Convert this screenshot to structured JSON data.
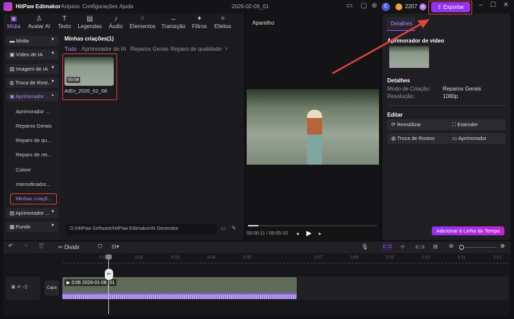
{
  "app": {
    "title": "HitPaw Edimakor",
    "menu": [
      "Arquivo",
      "Configurações",
      "Ajuda"
    ],
    "project": "2026-02-08_01",
    "credits": "2207",
    "avatar": "C",
    "export": "Exportar"
  },
  "toolbar": [
    "Mídia",
    "Avatar AI",
    "Texto",
    "Legendas",
    "Áudio",
    "Elementos",
    "Transição",
    "Filtros",
    "Efeitos"
  ],
  "sidebar": {
    "groups": [
      "Mídia",
      "Vídeo de IA",
      "Imagem de IA",
      "Troca de Rost...",
      "Aprimorador ...",
      "Aprimorador ...",
      "Fundo"
    ],
    "subitems": [
      "Aprimorador ...",
      "Reparos Gerais",
      "Reparo de qu...",
      "Reparo de ret...",
      "Colorir",
      "Intensificador...",
      "Minhas criaçõ..."
    ]
  },
  "library": {
    "title": "Minhas criações(1)",
    "tabs": [
      "Tudo",
      "Aprimorador de IA",
      "Reparos Gerais",
      "Reparo de qualidade"
    ],
    "item": {
      "duration": "00:06",
      "name": "AIEn_2026_02_08"
    },
    "path": "D:/HitPaw Software/HitPaw Edimakor/AI Generator"
  },
  "preview": {
    "title": "Aparelho",
    "time": "00:00:11 / 00:05:10",
    "progress": 0.08
  },
  "details": {
    "tab": "Detalhes",
    "section": "Aprimorador de vídeo",
    "details_title": "Detalhes",
    "mode_label": "Modo de Criação:",
    "mode_value": "Reparos Gerais",
    "res_label": "Resolução:",
    "res_value": "1080p",
    "edit_title": "Editar",
    "buttons": [
      "Reestilizar",
      "Estender",
      "Troca de Rostos",
      "Aprimorador"
    ],
    "add": "Adicionar à Linha do Tempo"
  },
  "timeline": {
    "split": "Dividir",
    "ticks": [
      "0:01",
      "0:02",
      "0:03",
      "0:04",
      "0:05",
      "0:07",
      "0:08",
      "0:09",
      "0:10",
      "0:11",
      "0:12"
    ],
    "cover": "Capa",
    "clip": "0:06 2026-01-08_01"
  },
  "colors": {
    "accent": "#a855f7",
    "annotation": "#e0443a"
  }
}
